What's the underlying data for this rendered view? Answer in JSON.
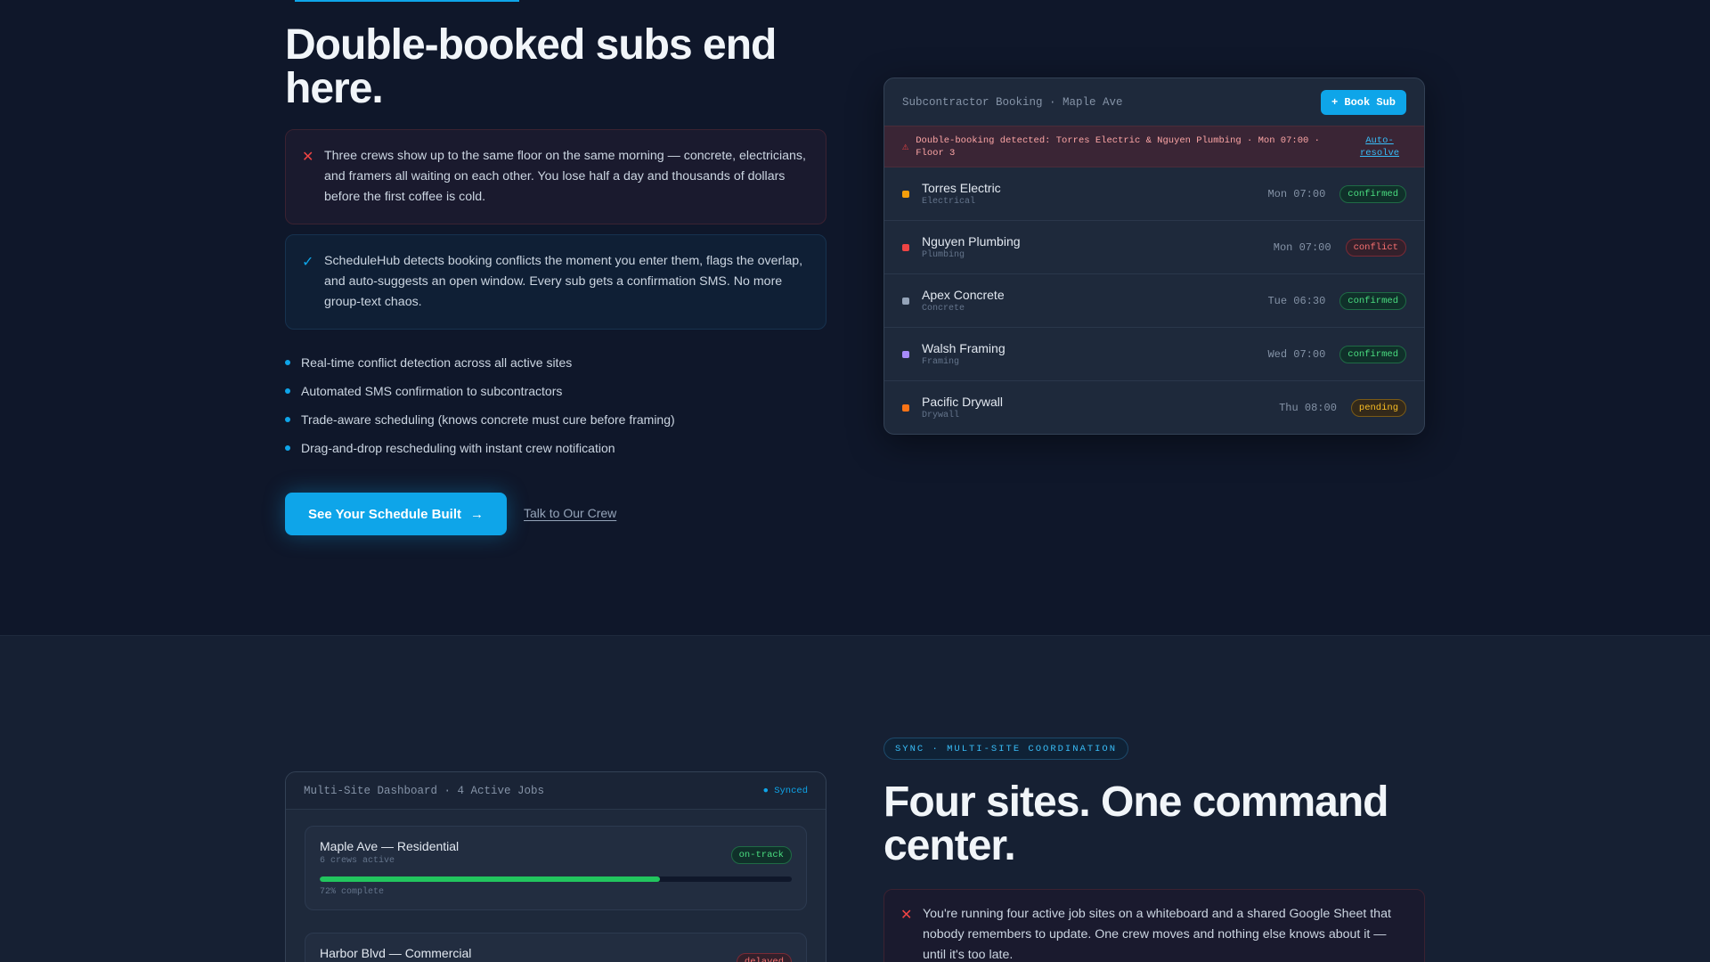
{
  "colors": {
    "accent": "#0ea5e9",
    "danger": "#ef4444",
    "success": "#22c55e",
    "warning": "#fbbf24",
    "background": "#0f172a"
  },
  "hero": {
    "title": "Double-booked subs end here.",
    "problem": "Three crews show up to the same floor on the same morning — concrete, electricians, and framers all waiting on each other. You lose half a day and thousands of dollars before the first coffee is cold.",
    "solution": "ScheduleHub detects booking conflicts the moment you enter them, flags the overlap, and auto-suggests an open window. Every sub gets a confirmation SMS. No more group-text chaos.",
    "features": [
      "Real-time conflict detection across all active sites",
      "Automated SMS confirmation to subcontractors",
      "Trade-aware scheduling (knows concrete must cure before framing)",
      "Drag-and-drop rescheduling with instant crew notification"
    ],
    "cta_primary": "See Your Schedule Built",
    "cta_secondary": "Talk to Our Crew"
  },
  "booking": {
    "title": "Subcontractor Booking · Maple Ave",
    "book_button": "+ Book Sub",
    "alert": "Double-booking detected: Torres Electric & Nguyen Plumbing · Mon 07:00 · Floor 3",
    "alert_action": "Auto-resolve",
    "rows": [
      {
        "name": "Torres Electric",
        "trade": "Electrical",
        "time": "Mon 07:00",
        "status": "confirmed",
        "color": "#f59e0b"
      },
      {
        "name": "Nguyen Plumbing",
        "trade": "Plumbing",
        "time": "Mon 07:00",
        "status": "conflict",
        "color": "#ef4444"
      },
      {
        "name": "Apex Concrete",
        "trade": "Concrete",
        "time": "Tue 06:30",
        "status": "confirmed",
        "color": "#94a3b8"
      },
      {
        "name": "Walsh Framing",
        "trade": "Framing",
        "time": "Wed 07:00",
        "status": "confirmed",
        "color": "#a78bfa"
      },
      {
        "name": "Pacific Drywall",
        "trade": "Drywall",
        "time": "Thu 08:00",
        "status": "pending",
        "color": "#f97316"
      }
    ]
  },
  "dashboard": {
    "title": "Multi-Site Dashboard · 4 Active Jobs",
    "synced": "Synced",
    "jobs": [
      {
        "name": "Maple Ave — Residential",
        "crews": "6 crews active",
        "status": "on-track",
        "progress": 0.72,
        "progress_label": "72% complete"
      },
      {
        "name": "Harbor Blvd — Commercial",
        "status": "delayed"
      }
    ]
  },
  "sync": {
    "eyebrow": "SYNC · MULTI-SITE COORDINATION",
    "title": "Four sites. One command center.",
    "problem": "You're running four active job sites on a whiteboard and a shared Google Sheet that nobody remembers to update. One crew moves and nothing else knows about it — until it's too late."
  }
}
